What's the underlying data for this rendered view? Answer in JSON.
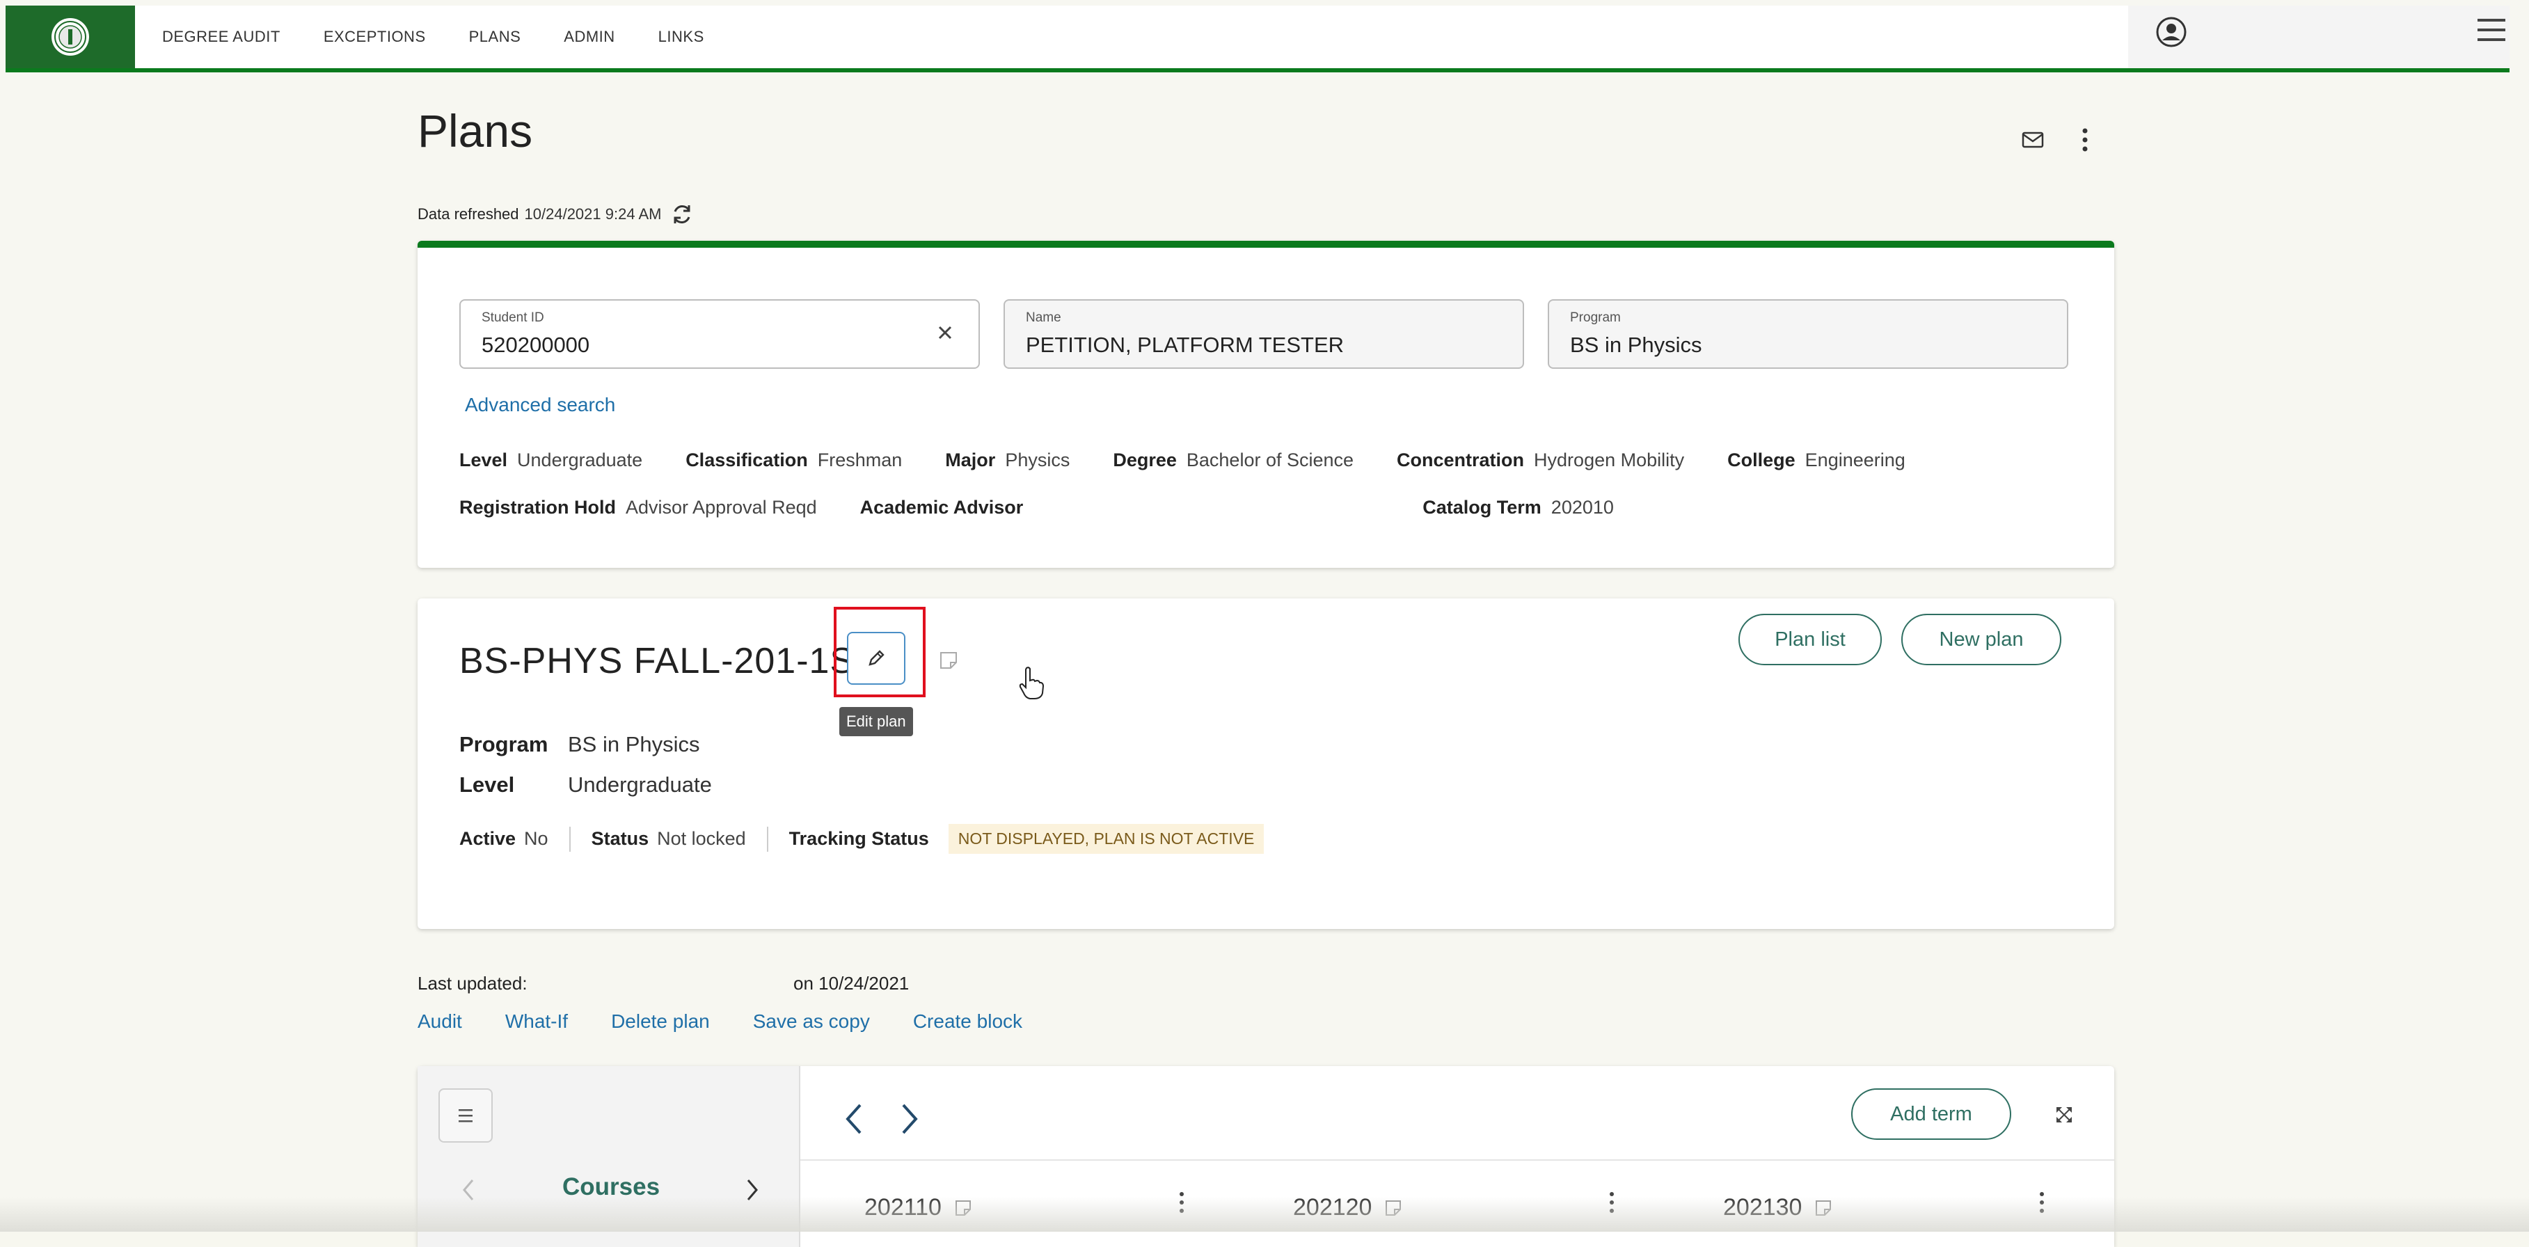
{
  "nav": {
    "items": [
      "DEGREE AUDIT",
      "EXCEPTIONS",
      "PLANS",
      "ADMIN",
      "LINKS"
    ],
    "brand_color": "#1e6b2a",
    "accent_color": "#0b7a1d",
    "icons": {
      "logo": "university-seal-icon",
      "user": "user-circle-icon",
      "menu": "hamburger-menu-icon"
    }
  },
  "page": {
    "title": "Plans",
    "refreshed_label": "Data refreshed",
    "refreshed_value": "10/24/2021 9:24 AM"
  },
  "student": {
    "id_label": "Student ID",
    "id_value": "520200000",
    "name_label": "Name",
    "name_value": "PETITION, PLATFORM TESTER",
    "program_label": "Program",
    "program_value": "BS in Physics",
    "advanced_search": "Advanced search",
    "row1": [
      {
        "k": "Level",
        "v": "Undergraduate"
      },
      {
        "k": "Classification",
        "v": "Freshman"
      },
      {
        "k": "Major",
        "v": "Physics"
      },
      {
        "k": "Degree",
        "v": "Bachelor of Science"
      },
      {
        "k": "Concentration",
        "v": "Hydrogen Mobility"
      },
      {
        "k": "College",
        "v": "Engineering"
      }
    ],
    "row2": [
      {
        "k": "Registration Hold",
        "v": "Advisor Approval Reqd"
      },
      {
        "k": "Academic Advisor",
        "v": ""
      },
      {
        "k": "Catalog Term",
        "v": "202010"
      }
    ]
  },
  "plan": {
    "title": "BS-PHYS FALL-201-1S",
    "edit_tooltip": "Edit plan",
    "plan_list_btn": "Plan list",
    "new_plan_btn": "New plan",
    "program_label": "Program",
    "program_value": "BS in Physics",
    "level_label": "Level",
    "level_value": "Undergraduate",
    "active_label": "Active",
    "active_value": "No",
    "status_label": "Status",
    "status_value": "Not locked",
    "tracking_label": "Tracking Status",
    "tracking_value": "NOT DISPLAYED, PLAN IS NOT ACTIVE"
  },
  "updated": {
    "label": "Last updated:",
    "value": "on 10/24/2021",
    "actions": [
      "Audit",
      "What-If",
      "Delete plan",
      "Save as copy",
      "Create block"
    ]
  },
  "planner": {
    "courses_label": "Courses",
    "add_term_btn": "Add term",
    "terms": [
      "202110",
      "202120",
      "202130"
    ]
  }
}
